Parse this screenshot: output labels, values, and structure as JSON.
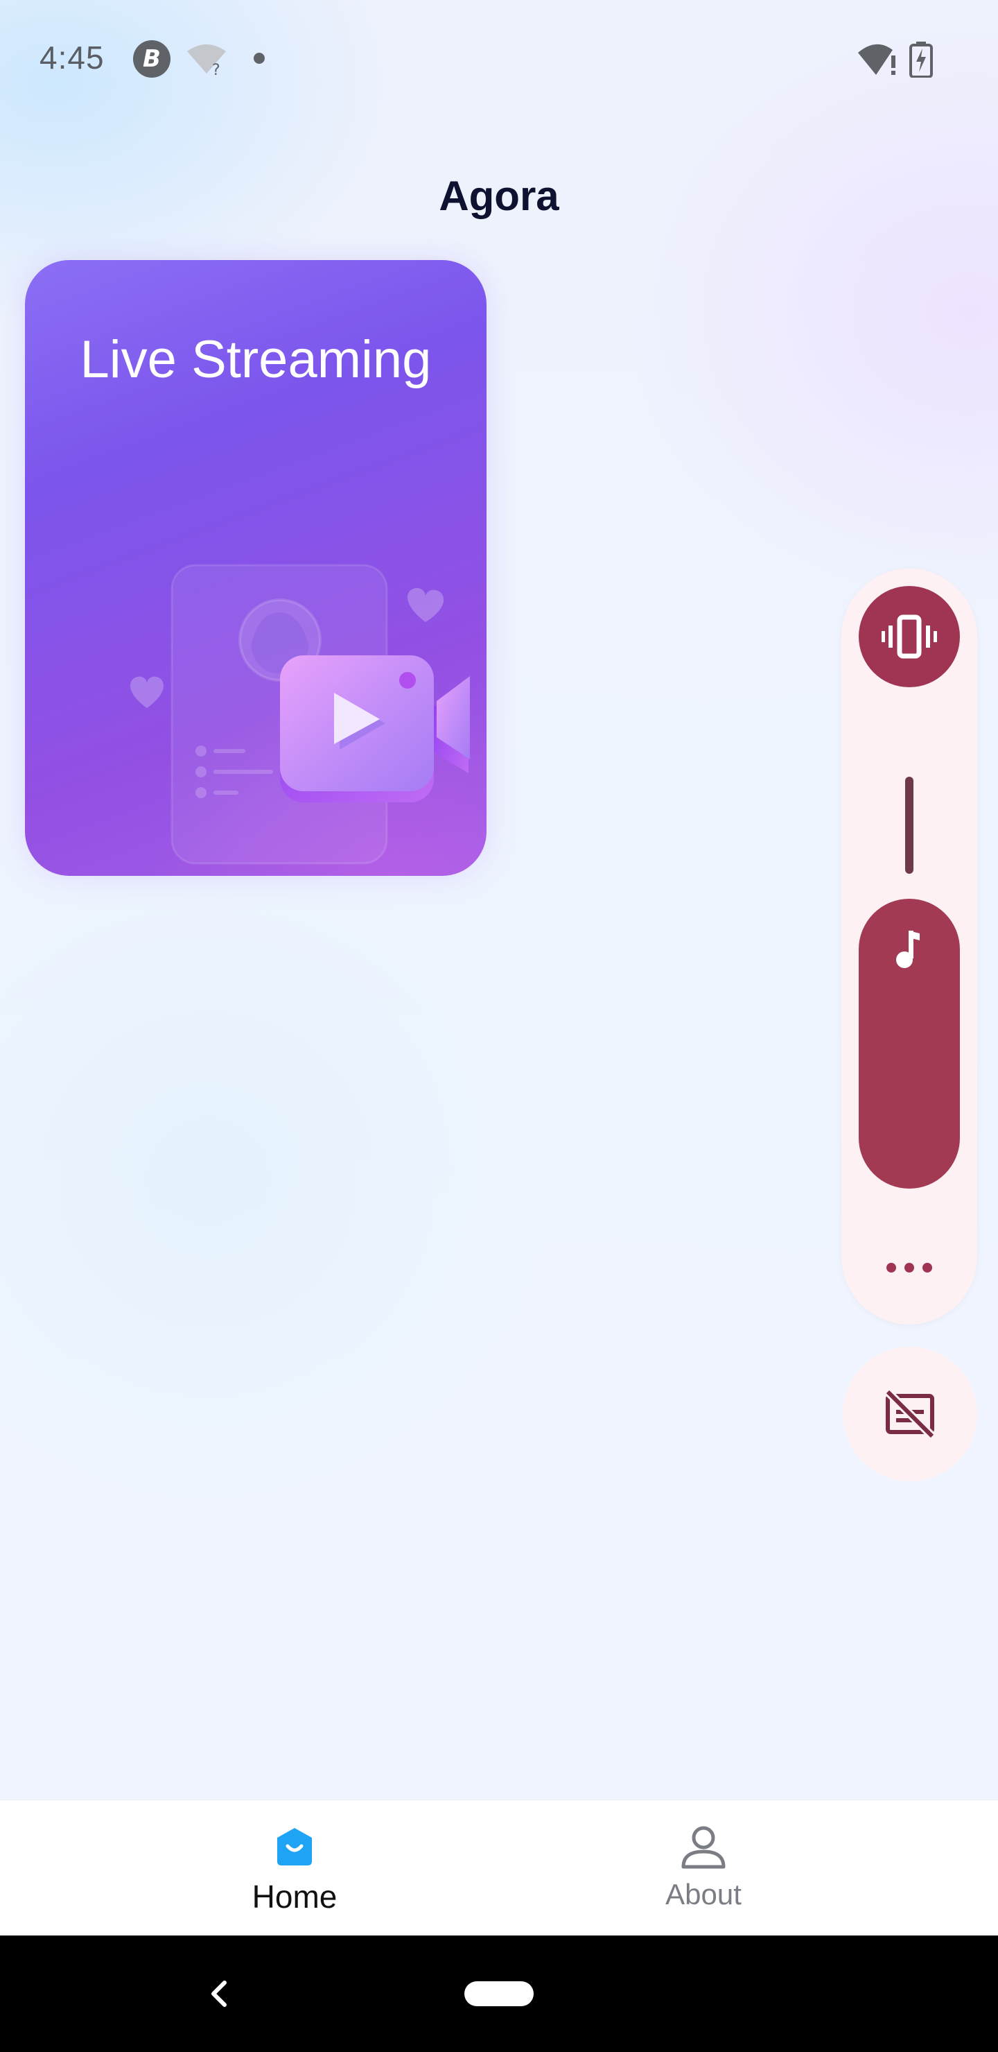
{
  "status_bar": {
    "time": "4:45",
    "icons": [
      "b-badge-icon",
      "wifi-unknown-icon",
      "notification-dot-icon",
      "wifi-alert-icon",
      "battery-charging-icon"
    ],
    "b_badge_letter": "B"
  },
  "header": {
    "title": "Agora"
  },
  "cards": [
    {
      "title": "Live Streaming",
      "illustration": "video-camera-illustration"
    }
  ],
  "volume_panel": {
    "vibrate_icon": "vibrate-icon",
    "music_icon": "music-note-icon",
    "more_icon": "more-horizontal-icon",
    "captions_icon": "captions-off-icon",
    "volume_level": 0.7,
    "accent_color": "#a33a53",
    "panel_color": "#fdf1f3"
  },
  "bottom_nav": {
    "items": [
      {
        "label": "Home",
        "icon": "home-icon",
        "active": true
      },
      {
        "label": "About",
        "icon": "person-icon",
        "active": false
      }
    ],
    "active_color": "#1fa3f5"
  },
  "system_nav": {
    "back_icon": "back-chevron-icon",
    "home_icon": "home-pill-icon"
  }
}
